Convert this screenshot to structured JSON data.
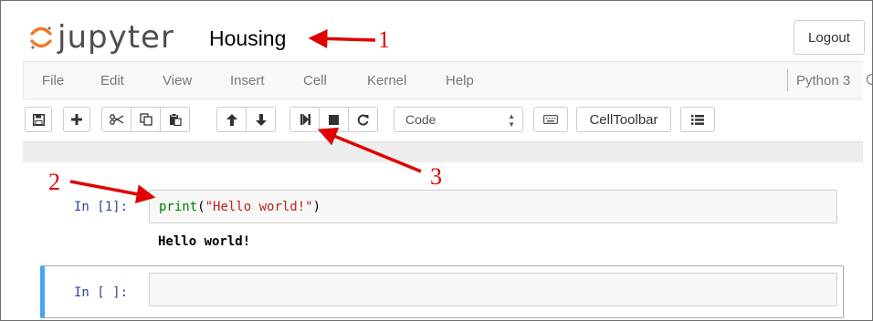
{
  "header": {
    "logo_text": "jupyter",
    "notebook_name": "Housing",
    "logout_label": "Logout"
  },
  "menubar": {
    "items": [
      "File",
      "Edit",
      "View",
      "Insert",
      "Cell",
      "Kernel",
      "Help"
    ],
    "kernel_name": "Python 3"
  },
  "toolbar": {
    "buttons": [
      {
        "name": "save",
        "icon": "floppy-disk-icon"
      },
      {
        "name": "insert-cell-below",
        "icon": "plus-icon"
      },
      {
        "name": "cut",
        "icon": "scissors-icon"
      },
      {
        "name": "copy",
        "icon": "copy-icon"
      },
      {
        "name": "paste",
        "icon": "paste-icon"
      },
      {
        "name": "move-up",
        "icon": "arrow-up-icon"
      },
      {
        "name": "move-down",
        "icon": "arrow-down-icon"
      },
      {
        "name": "run",
        "icon": "step-forward-icon"
      },
      {
        "name": "interrupt",
        "icon": "stop-icon"
      },
      {
        "name": "restart",
        "icon": "refresh-icon"
      },
      {
        "name": "command-palette",
        "icon": "keyboard-icon"
      },
      {
        "name": "toc",
        "icon": "list-icon"
      }
    ],
    "cell_type": "Code",
    "celltoolbar_label": "CellToolbar"
  },
  "cells": [
    {
      "prompt": "In [1]:",
      "code_func": "print",
      "code_open": "(",
      "code_string": "\"Hello world!\"",
      "code_close": ")",
      "output": "Hello world!"
    },
    {
      "prompt": "In [ ]:"
    }
  ],
  "annotations": {
    "n1": "1",
    "n2": "2",
    "n3": "3",
    "color": "#e00000"
  }
}
